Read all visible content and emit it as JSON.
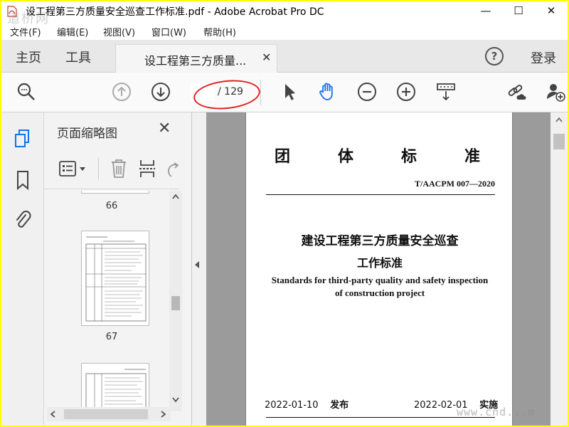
{
  "window": {
    "title": "设工程第三方质量安全巡查工作标准.pdf - Adobe Acrobat Pro DC",
    "minimize": "—",
    "maximize": "☐",
    "close": "✕"
  },
  "menu": [
    "文件(F)",
    "编辑(E)",
    "视图(V)",
    "窗口(W)",
    "帮助(H)"
  ],
  "tabs": {
    "home": "主页",
    "tools": "工具",
    "document": "设工程第三方质量...",
    "document_close": "✕",
    "help": "?",
    "login": "登录"
  },
  "toolbar": {
    "current_page": "",
    "page_total": "/ 129",
    "icons": [
      "search-icon",
      "page-up-icon",
      "page-down-icon",
      "select-arrow-icon",
      "hand-icon",
      "zoom-out-icon",
      "zoom-in-icon",
      "page-display-icon",
      "share-link-icon",
      "add-user-icon"
    ]
  },
  "side_icons": [
    "page-thumbnails-icon",
    "bookmark-icon",
    "attachment-icon"
  ],
  "thumb_panel": {
    "title": "页面缩略图",
    "close": "✕",
    "pages": [
      "66",
      "67"
    ]
  },
  "document": {
    "header_chars": [
      "团",
      "体",
      "标",
      "准"
    ],
    "code": "T/AACPM 007—2020",
    "cn_title_1": "建设工程第三方质量安全巡查",
    "cn_title_2": "工作标准",
    "en_title_1": "Standards for third-party quality and safety inspection",
    "en_title_2": "of construction project",
    "publish_date": "2022-01-10",
    "publish_label": "发布",
    "effective_date": "2022-02-01",
    "effective_label": "实施"
  },
  "watermarks": {
    "top_left": "道桥网",
    "bottom_right": "www.cnd...m"
  },
  "colors": {
    "highlight_ellipse": "#e02020",
    "accent_blue": "#1473e6",
    "frame": "#ffff00"
  }
}
